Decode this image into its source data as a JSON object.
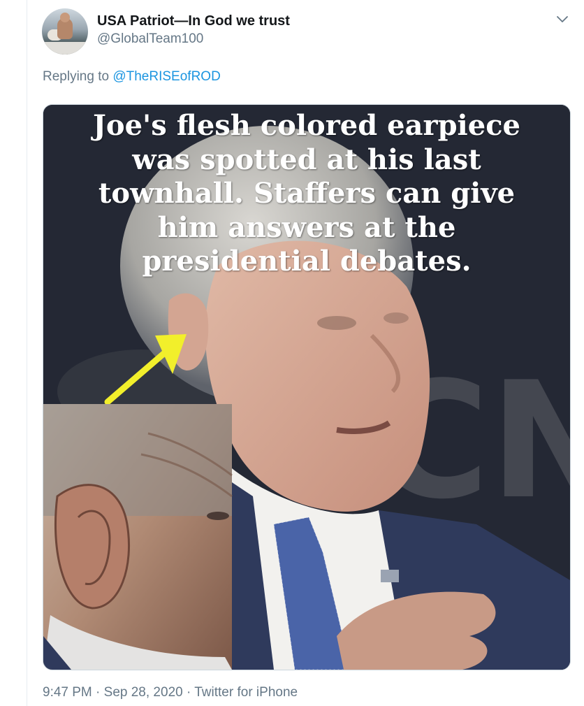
{
  "tweet": {
    "author_name": "USA Patriot—In God we trust",
    "author_handle": "@GlobalTeam100",
    "replying_prefix": "Replying to ",
    "replying_to": "@TheRISEofROD",
    "menu_icon": "chevron-down-icon",
    "media": {
      "caption_lines": [
        "Joe's flesh colored earpiece",
        "was spotted at his last",
        "townhall. Staffers can give",
        "him answers at the",
        "presidential debates."
      ],
      "background_logo_text": "CN",
      "annotation": "yellow arrow pointing at ear"
    },
    "time": "9:47 PM",
    "separator": " · ",
    "date": "Sep 28, 2020",
    "source": "Twitter for iPhone"
  },
  "colors": {
    "link": "#1b95e0",
    "secondary_text": "#657786",
    "primary_text": "#14171a",
    "arrow": "#f2ef2b"
  }
}
